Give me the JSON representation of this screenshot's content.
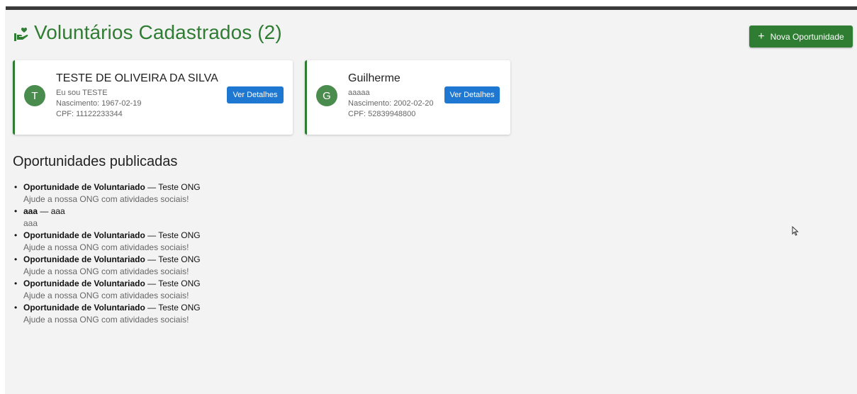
{
  "header": {
    "icon": "hand-heart-icon",
    "title": "Voluntários Cadastrados (2)",
    "new_button_icon": "plus-icon",
    "new_button_label": "Nova Oportunidade"
  },
  "colors": {
    "primary_green": "#2e7d32",
    "button_blue": "#1e78d2",
    "avatar_green": "#4a8b4e",
    "background": "#f3f3f3"
  },
  "volunteers": [
    {
      "initial": "T",
      "name": "TESTE DE OLIVEIRA DA SILVA",
      "bio": "Eu sou TESTE",
      "birth": "Nascimento: 1967-02-19",
      "cpf": "CPF: 11122233344",
      "details_label": "Ver Detalhes"
    },
    {
      "initial": "G",
      "name": "Guilherme",
      "bio": "aaaaa",
      "birth": "Nascimento: 2002-02-20",
      "cpf": "CPF: 52839948800",
      "details_label": "Ver Detalhes"
    }
  ],
  "opportunities_section": {
    "title": "Oportunidades publicadas",
    "items": [
      {
        "title": "Oportunidade de Voluntariado",
        "org": " — Teste ONG",
        "description": "Ajude a nossa ONG com atividades sociais!"
      },
      {
        "title": "aaa",
        "org": " — aaa",
        "description": "aaa"
      },
      {
        "title": "Oportunidade de Voluntariado",
        "org": " — Teste ONG",
        "description": "Ajude a nossa ONG com atividades sociais!"
      },
      {
        "title": "Oportunidade de Voluntariado",
        "org": " — Teste ONG",
        "description": "Ajude a nossa ONG com atividades sociais!"
      },
      {
        "title": "Oportunidade de Voluntariado",
        "org": " — Teste ONG",
        "description": "Ajude a nossa ONG com atividades sociais!"
      },
      {
        "title": "Oportunidade de Voluntariado",
        "org": " — Teste ONG",
        "description": "Ajude a nossa ONG com atividades sociais!"
      }
    ]
  }
}
